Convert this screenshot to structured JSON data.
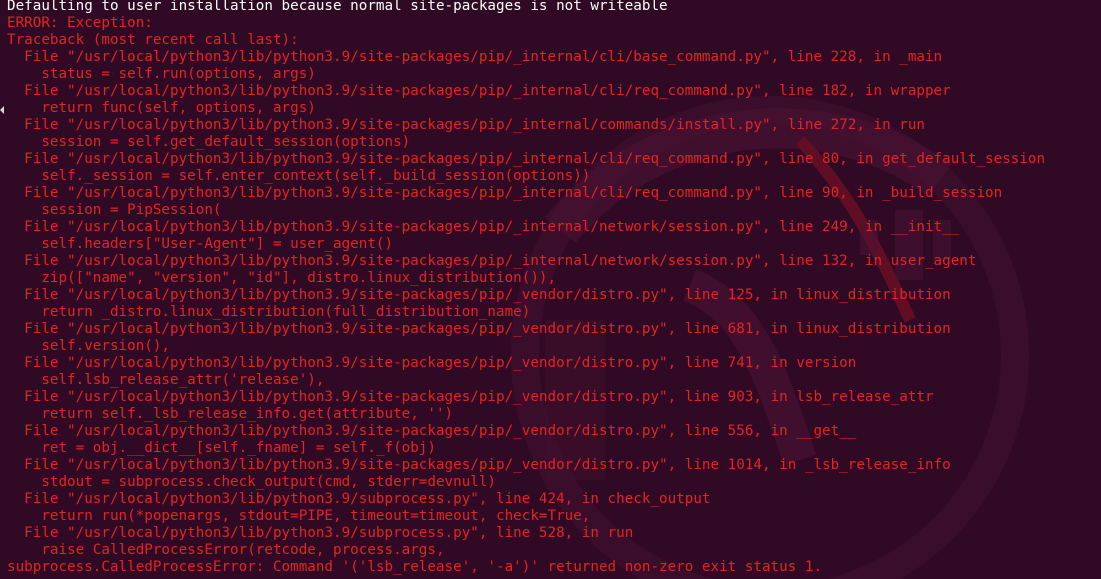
{
  "terminal": {
    "header_line": "Defaulting to user installation because normal site-packages is not writeable",
    "error_lines": [
      "ERROR: Exception:",
      "Traceback (most recent call last):",
      "  File \"/usr/local/python3/lib/python3.9/site-packages/pip/_internal/cli/base_command.py\", line 228, in _main",
      "    status = self.run(options, args)",
      "  File \"/usr/local/python3/lib/python3.9/site-packages/pip/_internal/cli/req_command.py\", line 182, in wrapper",
      "    return func(self, options, args)",
      "  File \"/usr/local/python3/lib/python3.9/site-packages/pip/_internal/commands/install.py\", line 272, in run",
      "    session = self.get_default_session(options)",
      "  File \"/usr/local/python3/lib/python3.9/site-packages/pip/_internal/cli/req_command.py\", line 80, in get_default_session",
      "    self._session = self.enter_context(self._build_session(options))",
      "  File \"/usr/local/python3/lib/python3.9/site-packages/pip/_internal/cli/req_command.py\", line 90, in _build_session",
      "    session = PipSession(",
      "  File \"/usr/local/python3/lib/python3.9/site-packages/pip/_internal/network/session.py\", line 249, in __init__",
      "    self.headers[\"User-Agent\"] = user_agent()",
      "  File \"/usr/local/python3/lib/python3.9/site-packages/pip/_internal/network/session.py\", line 132, in user_agent",
      "    zip([\"name\", \"version\", \"id\"], distro.linux_distribution()),",
      "  File \"/usr/local/python3/lib/python3.9/site-packages/pip/_vendor/distro.py\", line 125, in linux_distribution",
      "    return _distro.linux_distribution(full_distribution_name)",
      "  File \"/usr/local/python3/lib/python3.9/site-packages/pip/_vendor/distro.py\", line 681, in linux_distribution",
      "    self.version(),",
      "  File \"/usr/local/python3/lib/python3.9/site-packages/pip/_vendor/distro.py\", line 741, in version",
      "    self.lsb_release_attr('release'),",
      "  File \"/usr/local/python3/lib/python3.9/site-packages/pip/_vendor/distro.py\", line 903, in lsb_release_attr",
      "    return self._lsb_release_info.get(attribute, '')",
      "  File \"/usr/local/python3/lib/python3.9/site-packages/pip/_vendor/distro.py\", line 556, in __get__",
      "    ret = obj.__dict__[self._fname] = self._f(obj)",
      "  File \"/usr/local/python3/lib/python3.9/site-packages/pip/_vendor/distro.py\", line 1014, in _lsb_release_info",
      "    stdout = subprocess.check_output(cmd, stderr=devnull)",
      "  File \"/usr/local/python3/lib/python3.9/subprocess.py\", line 424, in check_output",
      "    return run(*popenargs, stdout=PIPE, timeout=timeout, check=True,",
      "  File \"/usr/local/python3/lib/python3.9/subprocess.py\", line 528, in run",
      "    raise CalledProcessError(retcode, process.args,",
      "subprocess.CalledProcessError: Command '('lsb_release', '-a')' returned non-zero exit status 1."
    ],
    "colors": {
      "background": "#300a24",
      "error_text": "#e32424",
      "normal_text": "#ffffff",
      "watermark": "#5a1236"
    },
    "icons": {
      "watermark": "ubuntu-logo-watermark-icon",
      "scroll": "scroll-indicator-icon"
    }
  }
}
